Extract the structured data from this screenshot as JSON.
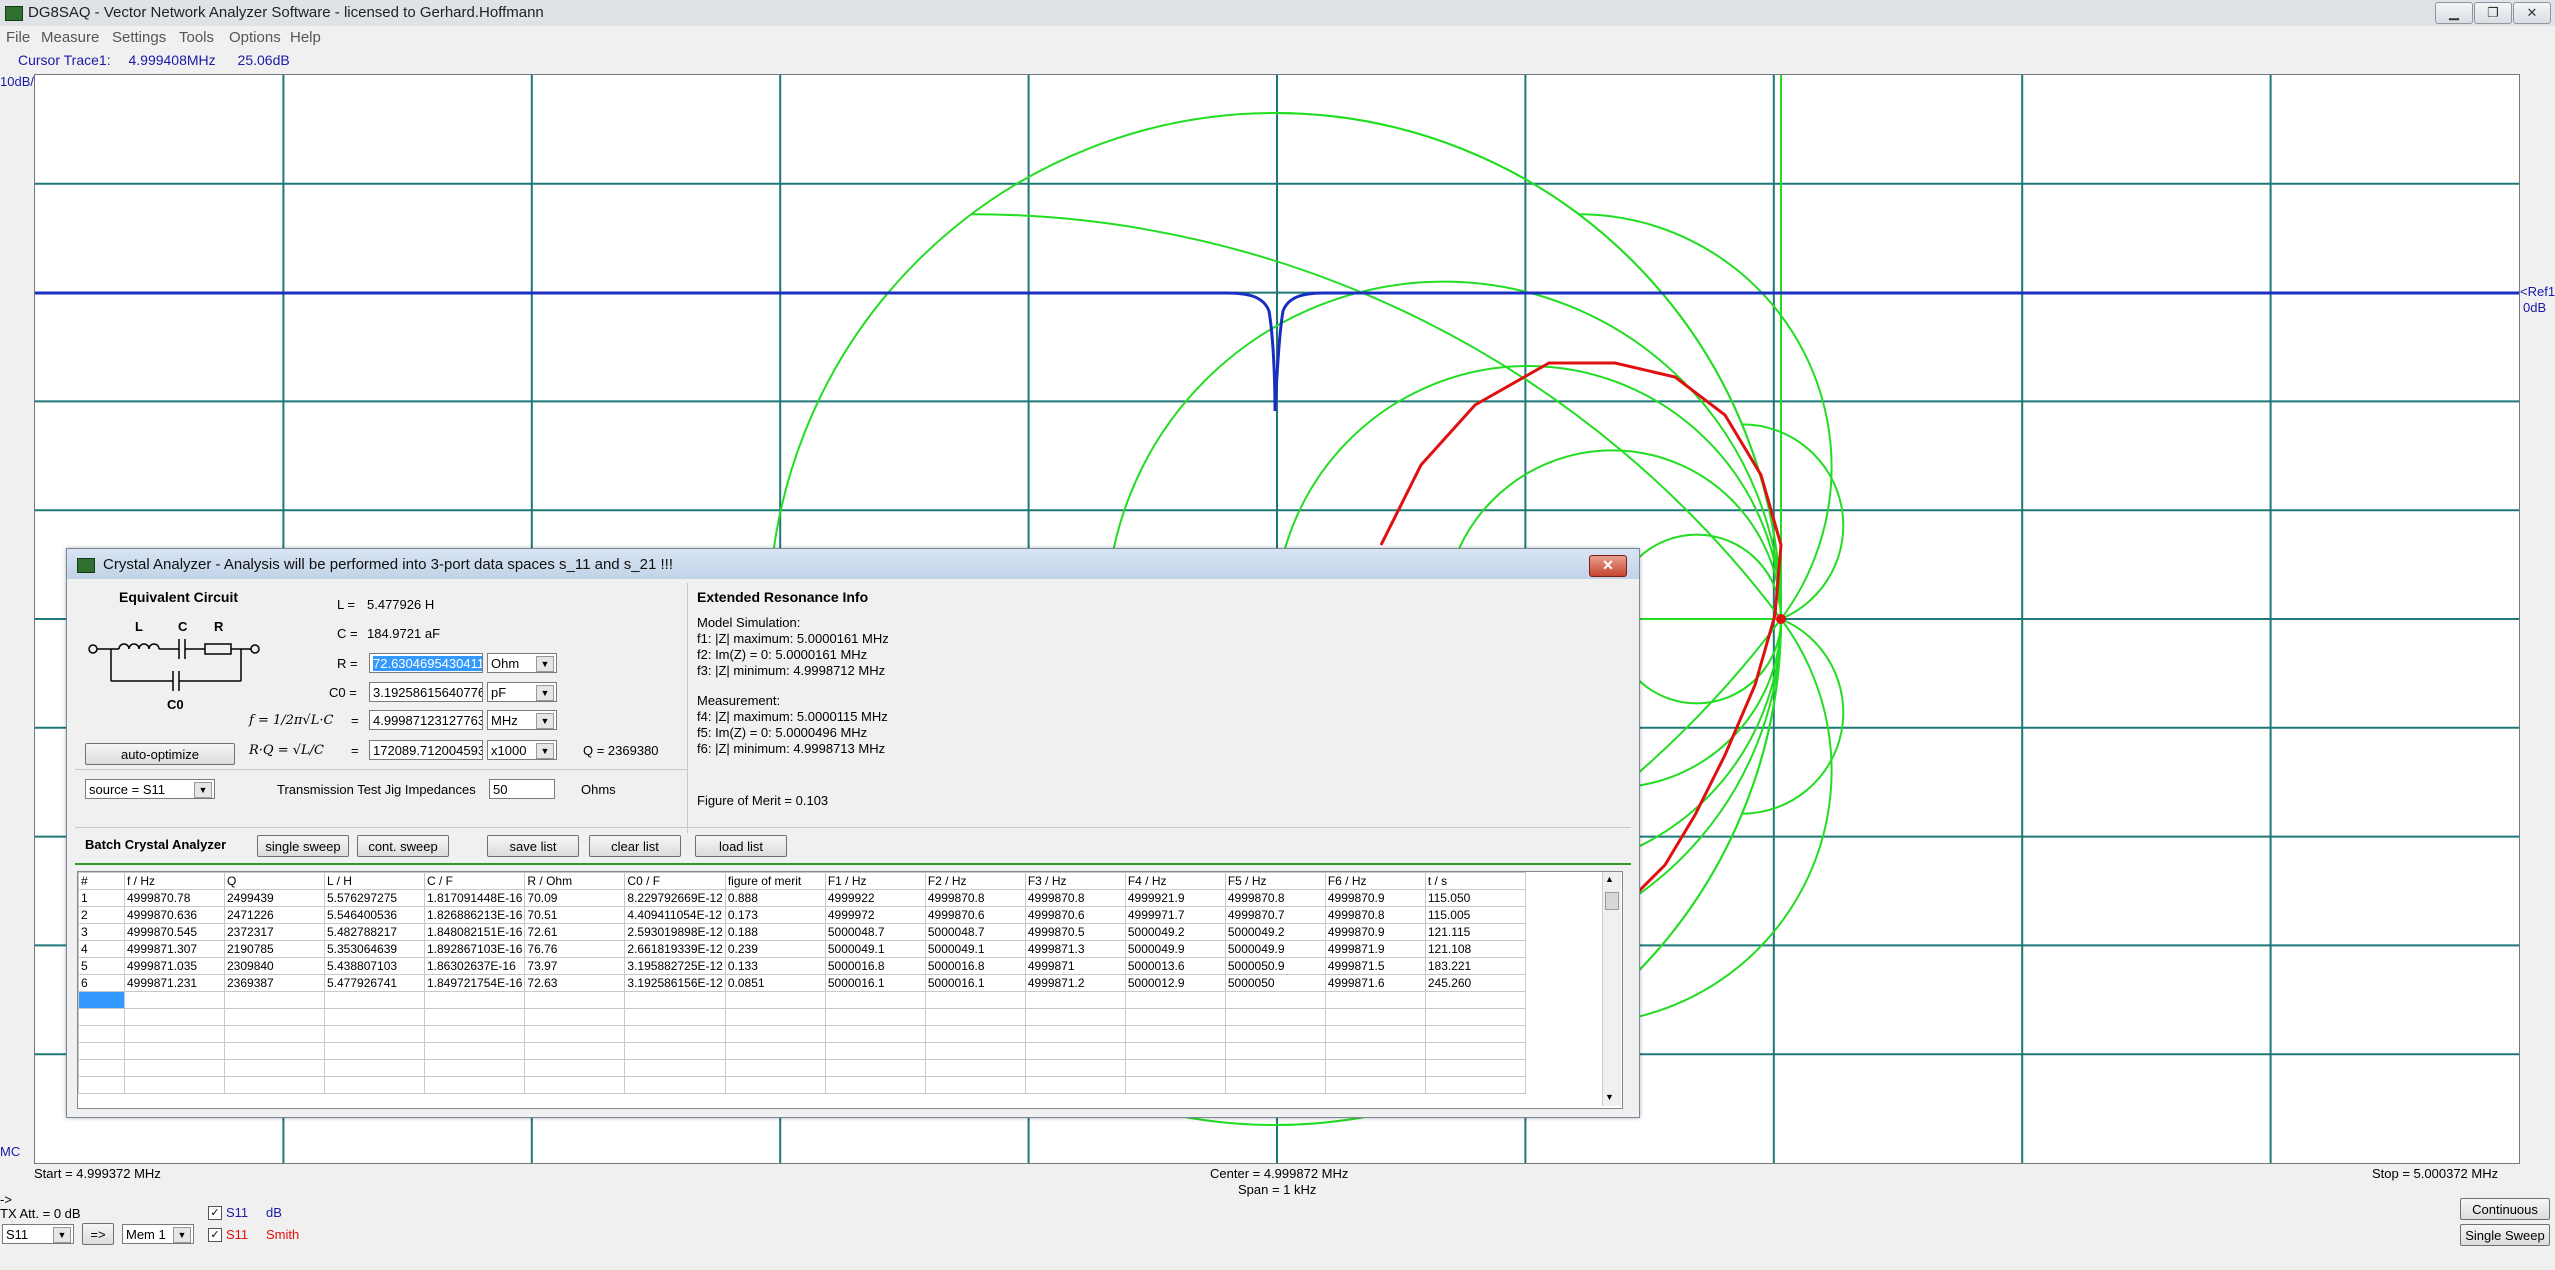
{
  "window": {
    "title": "DG8SAQ - Vector Network Analyzer Software  -  licensed to Gerhard.Hoffmann",
    "controls": {
      "minimize": "▁",
      "maximize": "❐",
      "close": "✕"
    }
  },
  "menu": [
    "File",
    "Measure",
    "Settings",
    "Tools",
    "Options",
    "Help"
  ],
  "cursor": {
    "label": "Cursor Trace1:",
    "freq": "4.999408MHz",
    "value": "25.06dB"
  },
  "plot": {
    "scale_label": "10dB/",
    "ref_label": "<Ref1",
    "ref_value": "0dB",
    "mc_label": "MC",
    "start": "Start = 4.999372 MHz",
    "center": "Center = 4.999872 MHz",
    "span": "Span = 1 kHz",
    "stop": "Stop = 5.000372 MHz",
    "colors": {
      "grid": "#1e7878",
      "smith": "#22dd22",
      "db_trace": "#1a2fc0",
      "smith_trace": "#e01010"
    }
  },
  "dialog": {
    "title": "Crystal Analyzer   -   Analysis will be performed into 3-port data spaces s_11 and s_21 !!!",
    "close": "✕",
    "equiv_title": "Equivalent Circuit",
    "circuit_labels": {
      "L": "L",
      "C": "C",
      "R": "R",
      "C0": "C0"
    },
    "L_label": "L =",
    "L_value": "5.477926 H",
    "C_label": "C =",
    "C_value": "184.9721 aF",
    "R_label": "R =",
    "R_value": "72.6304695430411",
    "R_unit": "Ohm",
    "C0_label": "C0 =",
    "C0_value": "3.19258615640776",
    "C0_unit": "pF",
    "f_formula": "f = 1/2π√L·C",
    "f_eq": "=",
    "f_value": "4.99987123127763",
    "f_unit": "MHz",
    "Q_formula": "R·Q = √L/C",
    "Q_eq": "=",
    "Q_value": "172089.712004593",
    "Q_unit": "x1000",
    "Q_result": "Q =  2369380",
    "auto_optimize": "auto-optimize",
    "source": "source = S11",
    "jig_label": "Transmission Test Jig Impedances",
    "jig_value": "50",
    "jig_unit": "Ohms",
    "ext_title": "Extended Resonance Info",
    "model_title": "Model Simulation:",
    "model_lines": [
      "f1: |Z| maximum: 5.0000161 MHz",
      "f2: Im(Z) = 0:      5.0000161 MHz",
      "f3: |Z| minimum:  4.9998712 MHz"
    ],
    "meas_title": "Measurement:",
    "meas_lines": [
      "f4: |Z| maximum: 5.0000115 MHz",
      "f5: Im(Z) = 0:      5.0000496 MHz",
      "f6: |Z| minimum:  4.9998713 MHz"
    ],
    "merit": "Figure of Merit = 0.103",
    "batch_title": "Batch Crystal Analyzer",
    "buttons": {
      "single": "single sweep",
      "cont": "cont. sweep",
      "save": "save list",
      "clear": "clear list",
      "load": "load list"
    },
    "table": {
      "headers": [
        "#",
        "f / Hz",
        "Q",
        "L / H",
        "C / F",
        "R / Ohm",
        "C0 / F",
        "figure of merit",
        "F1 / Hz",
        "F2 / Hz",
        "F3 / Hz",
        "F4 / Hz",
        "F5 / Hz",
        "F6 / Hz",
        "t / s"
      ],
      "rows": [
        [
          "1",
          "4999870.78",
          "2499439",
          "5.576297275",
          "1.817091448E-16",
          "70.09",
          "8.229792669E-12",
          "0.888",
          "4999922",
          "4999870.8",
          "4999870.8",
          "4999921.9",
          "4999870.8",
          "4999870.9",
          "115.050"
        ],
        [
          "2",
          "4999870.636",
          "2471226",
          "5.546400536",
          "1.826886213E-16",
          "70.51",
          "4.409411054E-12",
          "0.173",
          "4999972",
          "4999870.6",
          "4999870.6",
          "4999971.7",
          "4999870.7",
          "4999870.8",
          "115.005"
        ],
        [
          "3",
          "4999870.545",
          "2372317",
          "5.482788217",
          "1.848082151E-16",
          "72.61",
          "2.593019898E-12",
          "0.188",
          "5000048.7",
          "5000048.7",
          "4999870.5",
          "5000049.2",
          "5000049.2",
          "4999870.9",
          "121.115"
        ],
        [
          "4",
          "4999871.307",
          "2190785",
          "5.353064639",
          "1.892867103E-16",
          "76.76",
          "2.661819339E-12",
          "0.239",
          "5000049.1",
          "5000049.1",
          "4999871.3",
          "5000049.9",
          "5000049.9",
          "4999871.9",
          "121.108"
        ],
        [
          "5",
          "4999871.035",
          "2309840",
          "5.438807103",
          "1.86302637E-16",
          "73.97",
          "3.195882725E-12",
          "0.133",
          "5000016.8",
          "5000016.8",
          "4999871",
          "5000013.6",
          "5000050.9",
          "4999871.5",
          "183.221"
        ],
        [
          "6",
          "4999871.231",
          "2369387",
          "5.477926741",
          "1.849721754E-16",
          "72.63",
          "3.192586156E-12",
          "0.0851",
          "5000016.1",
          "5000016.1",
          "4999871.2",
          "5000012.9",
          "5000050",
          "4999871.6",
          "245.260"
        ]
      ]
    }
  },
  "bottom": {
    "arrow": "->",
    "tx_att": "TX Att. = 0 dB",
    "s_select": "S11",
    "arrow_btn": "=>",
    "mem_select": "Mem 1",
    "trace1": {
      "name": "S11",
      "format": "dB",
      "checked": "✓"
    },
    "trace2": {
      "name": "S11",
      "format": "Smith",
      "checked": "✓"
    },
    "continuous": "Continuous",
    "single_sweep": "Single Sweep"
  }
}
